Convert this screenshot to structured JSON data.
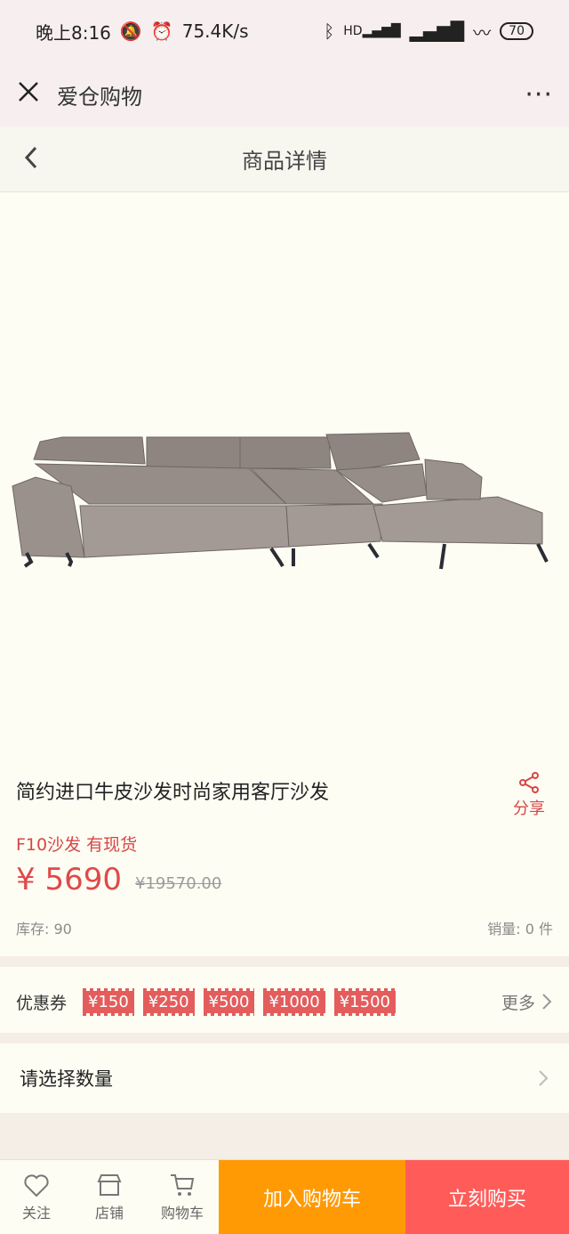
{
  "status_bar": {
    "time": "晚上8:16",
    "speed": "75.4K/s",
    "battery": "70",
    "hd_label": "HD"
  },
  "app_bar": {
    "title": "爱仓购物"
  },
  "header": {
    "title": "商品详情"
  },
  "product": {
    "title": "简约进口牛皮沙发时尚家用客厅沙发",
    "subtitle": "F10沙发 有现货",
    "price": "¥ 5690",
    "original_price": "¥19570.00",
    "stock": "库存: 90",
    "sales": "销量: 0 件",
    "share_label": "分享"
  },
  "coupon": {
    "label": "优惠券",
    "items": [
      "¥150",
      "¥250",
      "¥500",
      "¥1000",
      "¥1500"
    ],
    "more_label": "更多"
  },
  "quantity": {
    "label": "请选择数量"
  },
  "bottom_bar": {
    "follow": "关注",
    "store": "店铺",
    "cart": "购物车",
    "add_to_cart": "加入购物车",
    "buy_now": "立刻购买"
  },
  "colors": {
    "accent_red": "#e04949",
    "orange": "#ff9a05",
    "red_button": "#ff5c59",
    "sofa": "#8f8681"
  }
}
